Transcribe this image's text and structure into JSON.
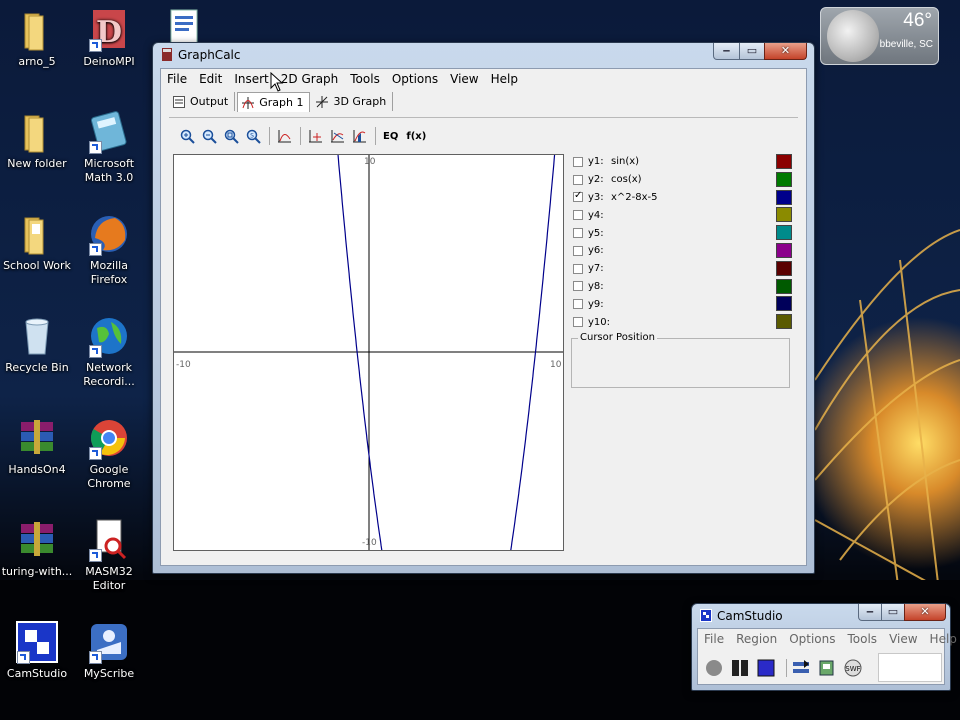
{
  "desktop": {
    "icons": [
      {
        "label": "arno_5",
        "icon": "folder-icon"
      },
      {
        "label": "DeinoMPI",
        "icon": "deinompi-icon"
      },
      {
        "label": "",
        "icon": "word-document-icon"
      },
      {
        "label": "New folder",
        "icon": "folder-icon"
      },
      {
        "label": "Microsoft Math 3.0",
        "icon": "calculator-icon"
      },
      {
        "label": "School Work",
        "icon": "folder-icon"
      },
      {
        "label": "Mozilla Firefox",
        "icon": "firefox-icon"
      },
      {
        "label": "Recycle Bin",
        "icon": "recycle-bin-icon"
      },
      {
        "label": "Network Recordi...",
        "icon": "globe-icon"
      },
      {
        "label": "HandsOn4",
        "icon": "winrar-icon"
      },
      {
        "label": "Google Chrome",
        "icon": "chrome-icon"
      },
      {
        "label": "turing-with...",
        "icon": "winrar-icon"
      },
      {
        "label": "MASM32 Editor",
        "icon": "masm-icon"
      },
      {
        "label": "CamStudio",
        "icon": "camstudio-icon"
      },
      {
        "label": "MyScribe",
        "icon": "myscribe-icon"
      }
    ],
    "weather": {
      "temperature": "46°",
      "city": "bbeville, SC"
    }
  },
  "graphcalc": {
    "title": "GraphCalc",
    "menu": [
      "File",
      "Edit",
      "Insert",
      "2D Graph",
      "Tools",
      "Options",
      "View",
      "Help"
    ],
    "tabs": [
      {
        "label": "Output",
        "icon": "output-icon",
        "active": false
      },
      {
        "label": "Graph 1",
        "icon": "graph-icon",
        "active": true
      },
      {
        "label": "3D Graph",
        "icon": "3d-graph-icon",
        "active": false
      }
    ],
    "toolbar": [
      {
        "name": "zoom-in-icon"
      },
      {
        "name": "zoom-out-icon"
      },
      {
        "name": "zoom-box-icon"
      },
      {
        "name": "zoom-standard-icon"
      },
      {
        "name": "graph-window-icon"
      },
      {
        "name": "trace-icon"
      },
      {
        "name": "derivative-icon"
      },
      {
        "name": "integral-icon"
      },
      {
        "name": "eq-button",
        "label": "EQ"
      },
      {
        "name": "fx-button",
        "label": "f(x)"
      }
    ],
    "plot": {
      "x_min_label": "-10",
      "x_max_label": "10",
      "y_max_label": "10",
      "y_min_label": "-10"
    },
    "functions": [
      {
        "name": "y1:",
        "expr": "sin(x)",
        "checked": false,
        "color": "#8b0000"
      },
      {
        "name": "y2:",
        "expr": "cos(x)",
        "checked": false,
        "color": "#007a00"
      },
      {
        "name": "y3:",
        "expr": "x^2-8x-5",
        "checked": true,
        "color": "#00008b"
      },
      {
        "name": "y4:",
        "expr": "",
        "checked": false,
        "color": "#8b8b00"
      },
      {
        "name": "y5:",
        "expr": "",
        "checked": false,
        "color": "#008b8b"
      },
      {
        "name": "y6:",
        "expr": "",
        "checked": false,
        "color": "#8b008b"
      },
      {
        "name": "y7:",
        "expr": "",
        "checked": false,
        "color": "#5a0000"
      },
      {
        "name": "y8:",
        "expr": "",
        "checked": false,
        "color": "#005a00"
      },
      {
        "name": "y9:",
        "expr": "",
        "checked": false,
        "color": "#00005a"
      },
      {
        "name": "y10:",
        "expr": "",
        "checked": false,
        "color": "#5a5a00"
      }
    ],
    "cursor_position_label": "Cursor Position"
  },
  "camstudio": {
    "title": "CamStudio",
    "menu": [
      "File",
      "Region",
      "Options",
      "Tools",
      "View",
      "Help"
    ],
    "buttons": [
      {
        "name": "record-icon"
      },
      {
        "name": "pause-icon"
      },
      {
        "name": "stop-icon"
      },
      {
        "name": "autopan-icon"
      },
      {
        "name": "annotation-icon"
      },
      {
        "name": "swf-icon"
      }
    ]
  }
}
